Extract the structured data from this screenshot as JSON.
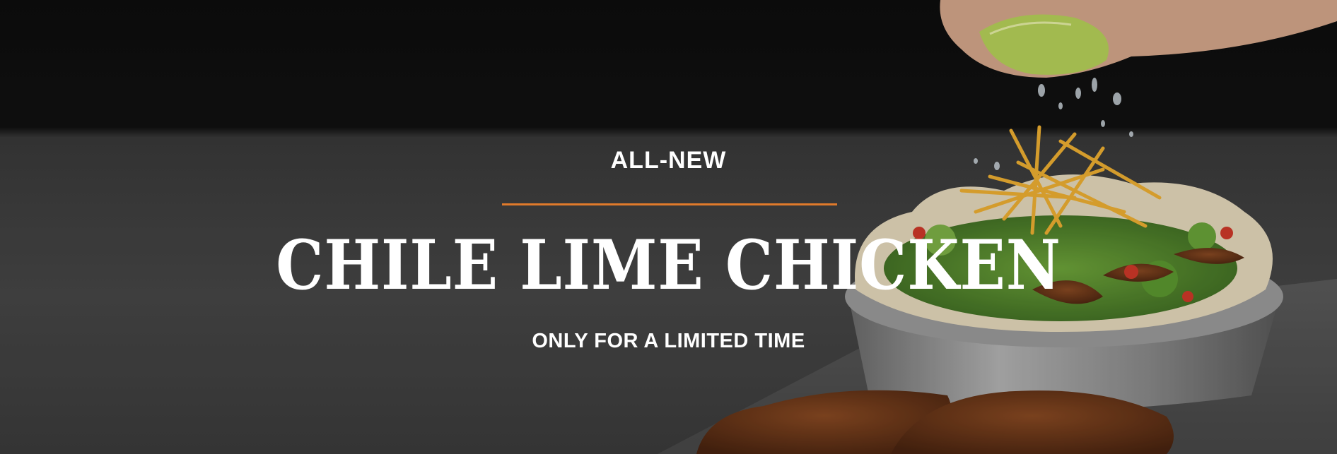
{
  "hero": {
    "eyebrow": "ALL-NEW",
    "title": "CHILE LIME CHICKEN",
    "subtitle": "ONLY FOR A LIMITED TIME",
    "colors": {
      "accent": "#e07a2b",
      "text": "#ffffff",
      "background": "#3f3f3f"
    }
  }
}
